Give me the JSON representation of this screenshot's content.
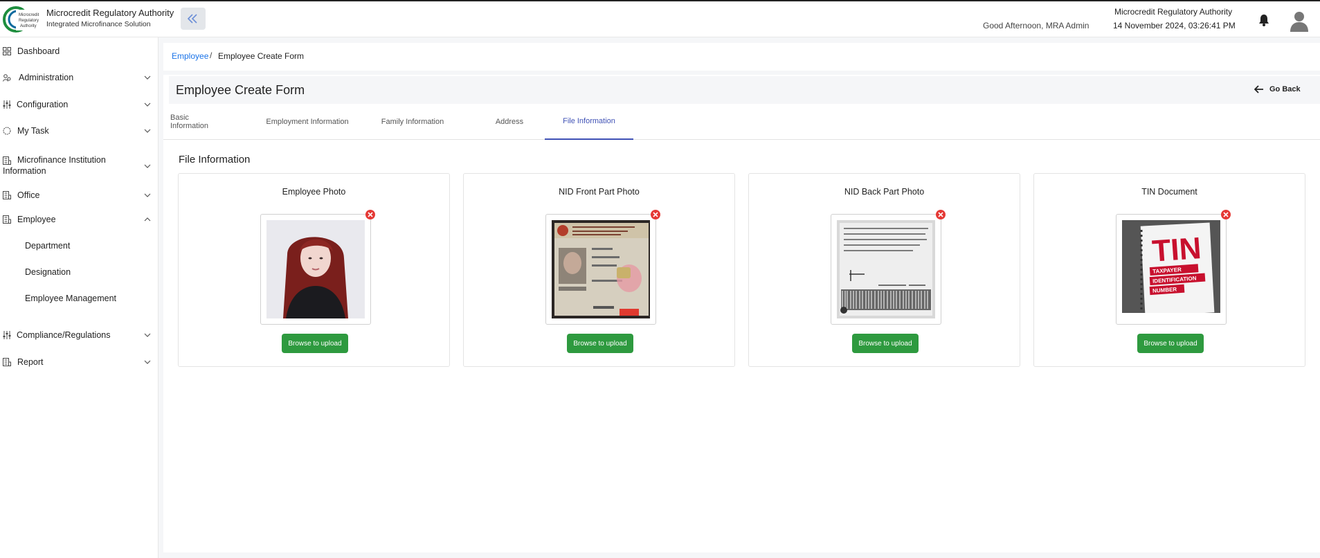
{
  "header": {
    "org_name": "Microcredit Regulatory Authority",
    "org_subtitle": "Integrated Microfinance Solution",
    "logo_text": [
      "Microcredit",
      "Regulatory",
      "Authority"
    ],
    "greeting": "Good Afternoon, MRA Admin",
    "org_name_right": "Microcredit Regulatory Authority",
    "datetime": "14 November 2024, 03:26:41 PM",
    "icons": [
      "collapse-sidebar-icon",
      "bell-icon",
      "user-avatar-icon"
    ]
  },
  "sidebar": {
    "items": [
      {
        "label": "Dashboard",
        "icon": "grid-icon"
      },
      {
        "label": "Administration",
        "icon": "people-icon",
        "expandable": true
      },
      {
        "label": "Configuration",
        "icon": "sliders-icon",
        "expandable": true
      },
      {
        "label": "My Task",
        "icon": "circle-icon",
        "expandable": true
      },
      {
        "label": "Microfinance Institution",
        "label_line2": "Information",
        "icon": "building-icon",
        "expandable": true
      },
      {
        "label": "Office",
        "icon": "building-icon",
        "expandable": true
      },
      {
        "label": "Employee",
        "icon": "building-icon",
        "expandable": true,
        "expanded": true
      },
      {
        "label": "Compliance/Regulations",
        "icon": "sliders-icon",
        "expandable": true
      },
      {
        "label": "Report",
        "icon": "building-icon",
        "expandable": true
      }
    ],
    "employee_sub_items": [
      "Department",
      "Designation",
      "Employee Management"
    ]
  },
  "breadcrumb": {
    "link": "Employee",
    "separator": "/",
    "current": "Employee Create Form"
  },
  "page": {
    "title": "Employee Create Form",
    "go_back": "Go Back",
    "section_title": "File Information"
  },
  "tabs": [
    {
      "label": "Basic Information",
      "active": false
    },
    {
      "label": "Employment Information",
      "active": false
    },
    {
      "label": "Family Information",
      "active": false
    },
    {
      "label": "Address",
      "active": false
    },
    {
      "label": "File Information",
      "active": true
    }
  ],
  "files": [
    {
      "title": "Employee Photo",
      "button": "Browse to upload"
    },
    {
      "title": "NID Front Part Photo",
      "button": "Browse to upload"
    },
    {
      "title": "NID Back Part Photo",
      "button": "Browse to upload"
    },
    {
      "title": "TIN Document",
      "button": "Browse to upload",
      "image_text": [
        "TIN",
        "TAXPAYER",
        "IDENTIFICATION",
        "NUMBER"
      ]
    }
  ],
  "colors": {
    "accent_blue": "#1a73e8",
    "active_tab": "#3f51b5",
    "upload_button": "#2e9a3f",
    "remove_icon": "#e53935"
  }
}
